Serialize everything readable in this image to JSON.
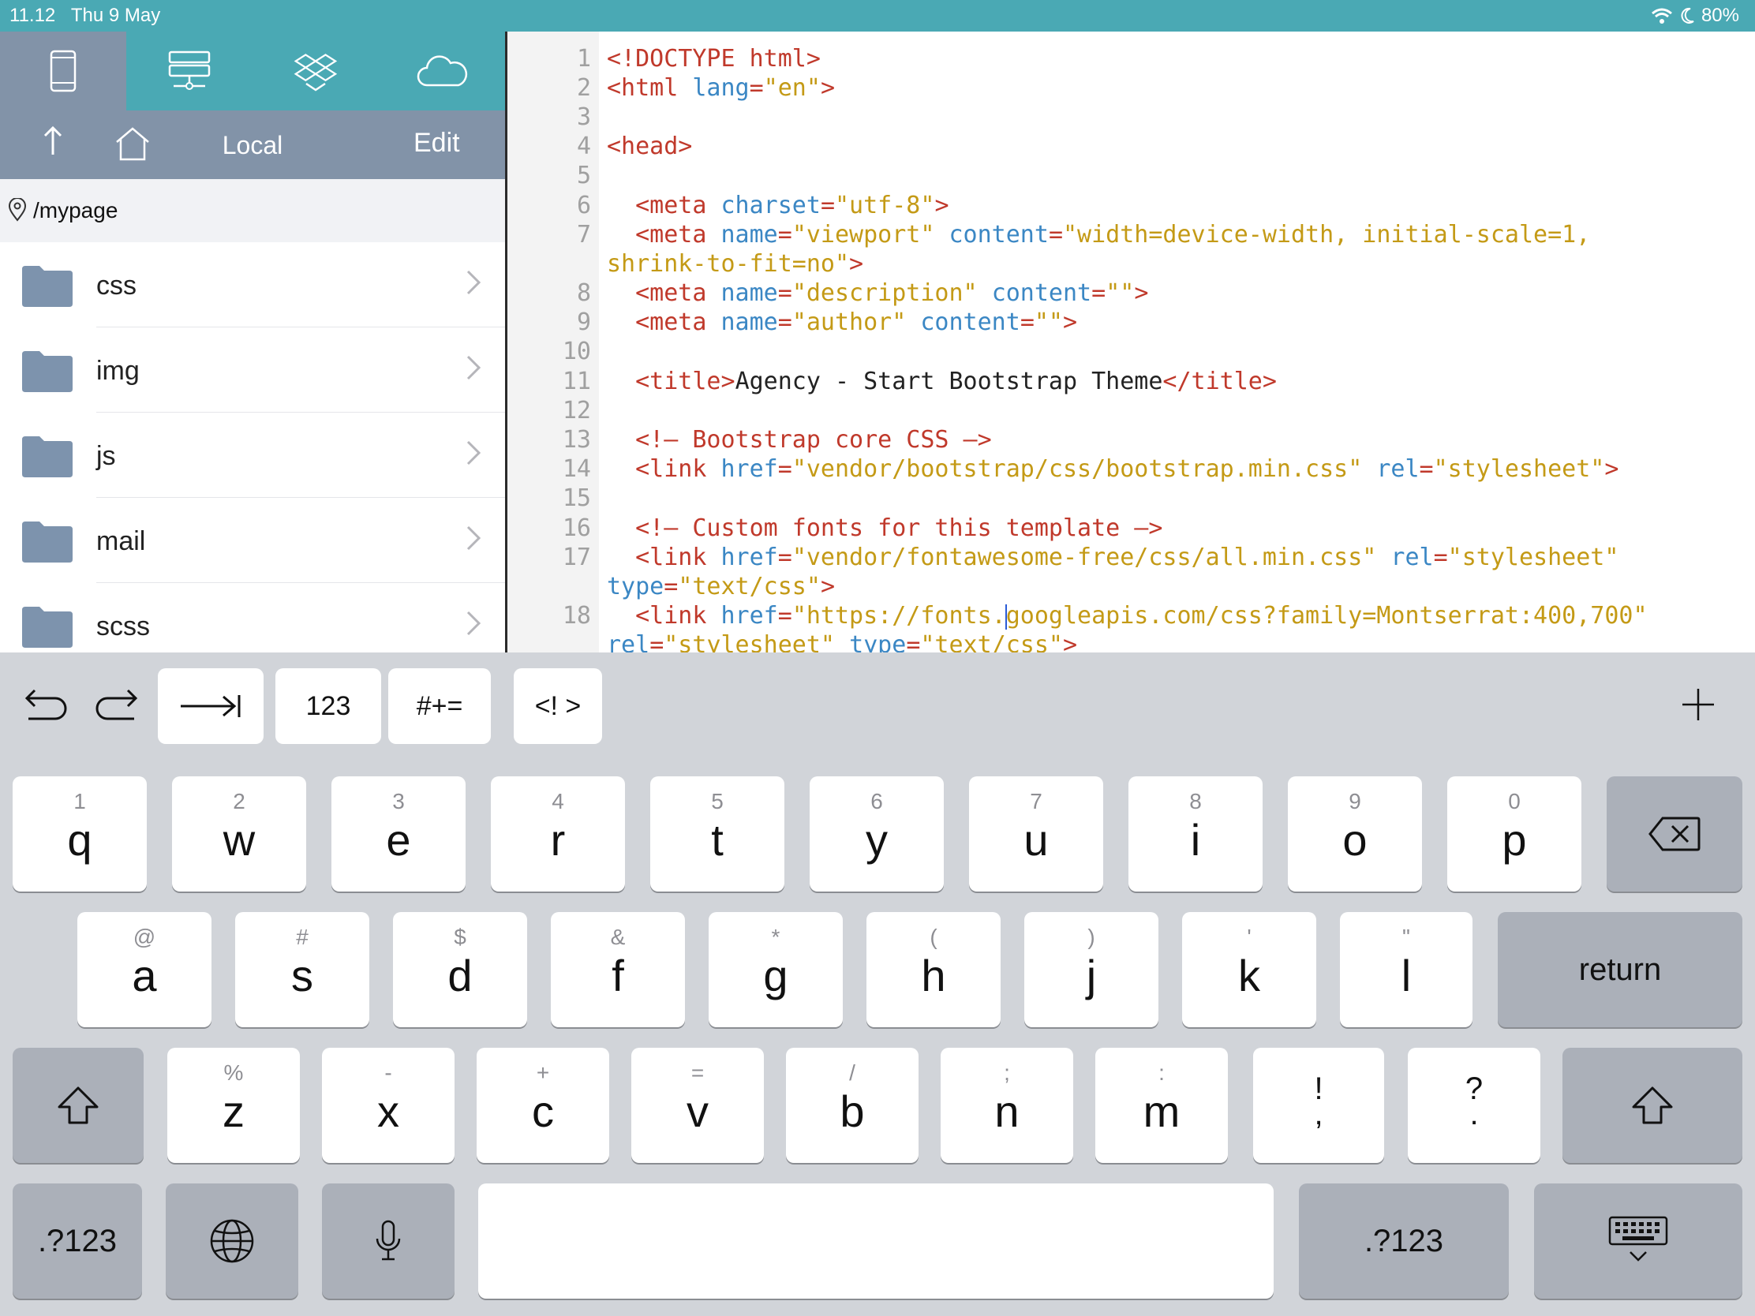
{
  "status": {
    "time": "11.12",
    "date": "Thu 9 May",
    "battery": "80%"
  },
  "sidebar": {
    "sources": [
      "device-icon",
      "server-icon",
      "dropbox-icon",
      "cloud-icon"
    ],
    "nav": {
      "title": "Local",
      "edit": "Edit"
    },
    "path": "/mypage",
    "folders": [
      "css",
      "img",
      "js",
      "mail",
      "scss"
    ]
  },
  "editor": {
    "line_numbers": [
      "1",
      "2",
      "3",
      "4",
      "5",
      "6",
      "7",
      "8",
      "9",
      "10",
      "11",
      "12",
      "13",
      "14",
      "15",
      "16",
      "17",
      "18"
    ]
  },
  "accessory": {
    "k123": "123",
    "symbols": "#+=",
    "comment": "<! >"
  },
  "keyboard": {
    "row1": [
      {
        "main": "q",
        "alt": "1"
      },
      {
        "main": "w",
        "alt": "2"
      },
      {
        "main": "e",
        "alt": "3"
      },
      {
        "main": "r",
        "alt": "4"
      },
      {
        "main": "t",
        "alt": "5"
      },
      {
        "main": "y",
        "alt": "6"
      },
      {
        "main": "u",
        "alt": "7"
      },
      {
        "main": "i",
        "alt": "8"
      },
      {
        "main": "o",
        "alt": "9"
      },
      {
        "main": "p",
        "alt": "0"
      }
    ],
    "row2": [
      {
        "main": "a",
        "alt": "@"
      },
      {
        "main": "s",
        "alt": "#"
      },
      {
        "main": "d",
        "alt": "$"
      },
      {
        "main": "f",
        "alt": "&"
      },
      {
        "main": "g",
        "alt": "*"
      },
      {
        "main": "h",
        "alt": "("
      },
      {
        "main": "j",
        "alt": ")"
      },
      {
        "main": "k",
        "alt": "'"
      },
      {
        "main": "l",
        "alt": "\""
      }
    ],
    "row3": [
      {
        "main": "z",
        "alt": "%"
      },
      {
        "main": "x",
        "alt": "-"
      },
      {
        "main": "c",
        "alt": "+"
      },
      {
        "main": "v",
        "alt": "="
      },
      {
        "main": "b",
        "alt": "/"
      },
      {
        "main": "n",
        "alt": ";"
      },
      {
        "main": "m",
        "alt": ":"
      },
      {
        "main": ",",
        "alt": "!"
      },
      {
        "main": ".",
        "alt": "?"
      }
    ],
    "return": "return",
    "num_left": ".?123",
    "num_right": ".?123"
  }
}
